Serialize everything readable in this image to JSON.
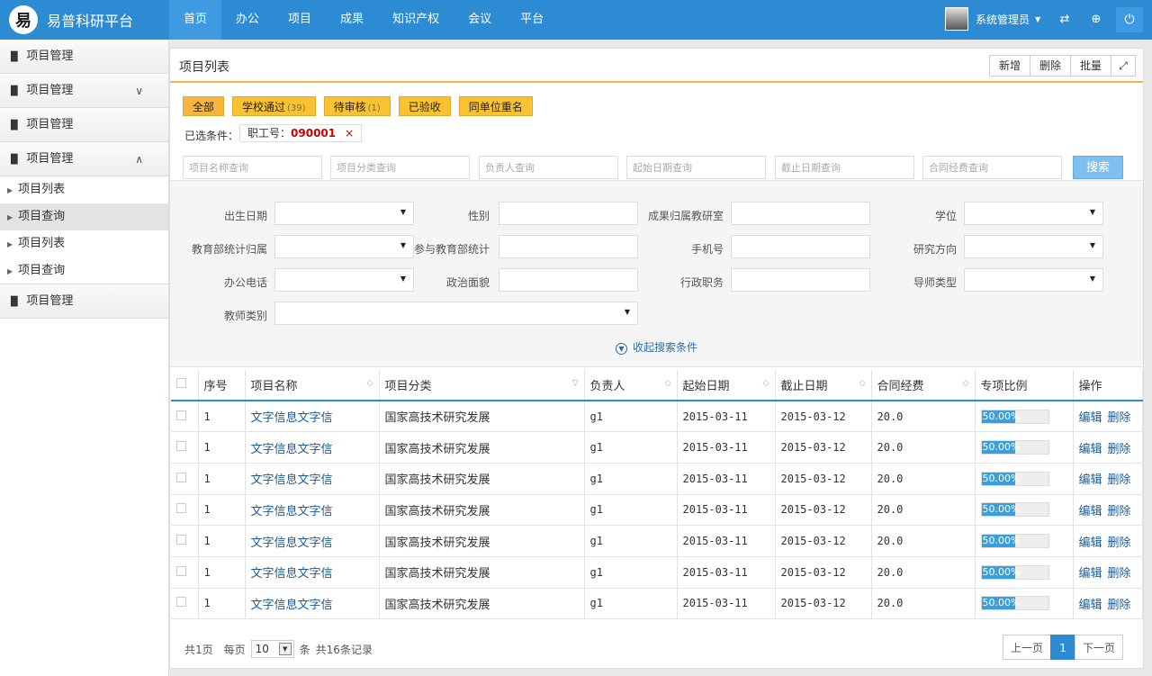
{
  "app": {
    "logo_char": "易",
    "title": "易普科研平台"
  },
  "nav": [
    "首页",
    "办公",
    "项目",
    "成果",
    "知识产权",
    "会议",
    "平台"
  ],
  "user": {
    "name": "系统管理员"
  },
  "sidebar": {
    "groups": [
      "项目管理",
      "项目管理",
      "项目管理",
      "项目管理",
      "项目管理"
    ],
    "subs": [
      "项目列表",
      "项目查询",
      "项目列表",
      "项目查询"
    ]
  },
  "panel": {
    "title": "项目列表",
    "tools": [
      "新增",
      "删除",
      "批量"
    ]
  },
  "filters": [
    {
      "label": "全部",
      "count": ""
    },
    {
      "label": "学校通过",
      "count": "(39)"
    },
    {
      "label": "待审核",
      "count": "(1)"
    },
    {
      "label": "已验收",
      "count": ""
    },
    {
      "label": "同单位重名",
      "count": ""
    }
  ],
  "cond": {
    "label": "已选条件：",
    "chip_key": "职工号：",
    "chip_val": "090001",
    "chip_x": "×"
  },
  "query": {
    "p1": "项目名称查询",
    "p2": "项目分类查询",
    "p3": "负责人查询",
    "p4": "起始日期查询",
    "p5": "截止日期查询",
    "p6": "合同经费查询",
    "search": "搜索"
  },
  "adv": {
    "l1": "出生日期",
    "l2": "性别",
    "l3": "成果归属教研室",
    "l4": "学位",
    "l5": "教育部统计归属",
    "l6": "参与教育部统计",
    "l7": "手机号",
    "l8": "研究方向",
    "l9": "办公电话",
    "l10": "政治面貌",
    "l11": "行政职务",
    "l12": "导师类型",
    "l13": "教师类别",
    "collapse": "收起搜索条件"
  },
  "table": {
    "headers": [
      "序号",
      "项目名称",
      "项目分类",
      "负责人",
      "起始日期",
      "截止日期",
      "合同经费",
      "专项比例",
      "操作"
    ],
    "rows": [
      {
        "no": "1",
        "name": "文字信息文字信",
        "cat": "国家高技术研究发展",
        "owner": "g1",
        "start": "2015-03-11",
        "end": "2015-03-12",
        "fund": "20.0",
        "ratio": "50.00%",
        "edit": "编辑",
        "del": "删除"
      },
      {
        "no": "1",
        "name": "文字信息文字信",
        "cat": "国家高技术研究发展",
        "owner": "g1",
        "start": "2015-03-11",
        "end": "2015-03-12",
        "fund": "20.0",
        "ratio": "50.00%",
        "edit": "编辑",
        "del": "删除"
      },
      {
        "no": "1",
        "name": "文字信息文字信",
        "cat": "国家高技术研究发展",
        "owner": "g1",
        "start": "2015-03-11",
        "end": "2015-03-12",
        "fund": "20.0",
        "ratio": "50.00%",
        "edit": "编辑",
        "del": "删除"
      },
      {
        "no": "1",
        "name": "文字信息文字信",
        "cat": "国家高技术研究发展",
        "owner": "g1",
        "start": "2015-03-11",
        "end": "2015-03-12",
        "fund": "20.0",
        "ratio": "50.00%",
        "edit": "编辑",
        "del": "删除"
      },
      {
        "no": "1",
        "name": "文字信息文字信",
        "cat": "国家高技术研究发展",
        "owner": "g1",
        "start": "2015-03-11",
        "end": "2015-03-12",
        "fund": "20.0",
        "ratio": "50.00%",
        "edit": "编辑",
        "del": "删除"
      },
      {
        "no": "1",
        "name": "文字信息文字信",
        "cat": "国家高技术研究发展",
        "owner": "g1",
        "start": "2015-03-11",
        "end": "2015-03-12",
        "fund": "20.0",
        "ratio": "50.00%",
        "edit": "编辑",
        "del": "删除"
      },
      {
        "no": "1",
        "name": "文字信息文字信",
        "cat": "国家高技术研究发展",
        "owner": "g1",
        "start": "2015-03-11",
        "end": "2015-03-12",
        "fund": "20.0",
        "ratio": "50.00%",
        "edit": "编辑",
        "del": "删除"
      }
    ]
  },
  "footer": {
    "pages": "共1页",
    "per_label": "每页",
    "per_val": "10",
    "unit": "条",
    "total": "共16条记录",
    "prev": "上一页",
    "cur": "1",
    "next": "下一页"
  },
  "icons": [
    "logo-icon",
    "link-icon",
    "plus-circle-icon",
    "power-icon",
    "bar-chart-icon",
    "chevron-down-icon",
    "chevron-up-icon",
    "triangle-right-icon",
    "expand-icon",
    "sort-icon",
    "select-arrow-icon",
    "collapse-circle-icon"
  ],
  "colors": {
    "primary": "#2c8bd2",
    "filter": "#f8c233",
    "progress": "#3aa0dd",
    "link": "#1f5a94"
  }
}
